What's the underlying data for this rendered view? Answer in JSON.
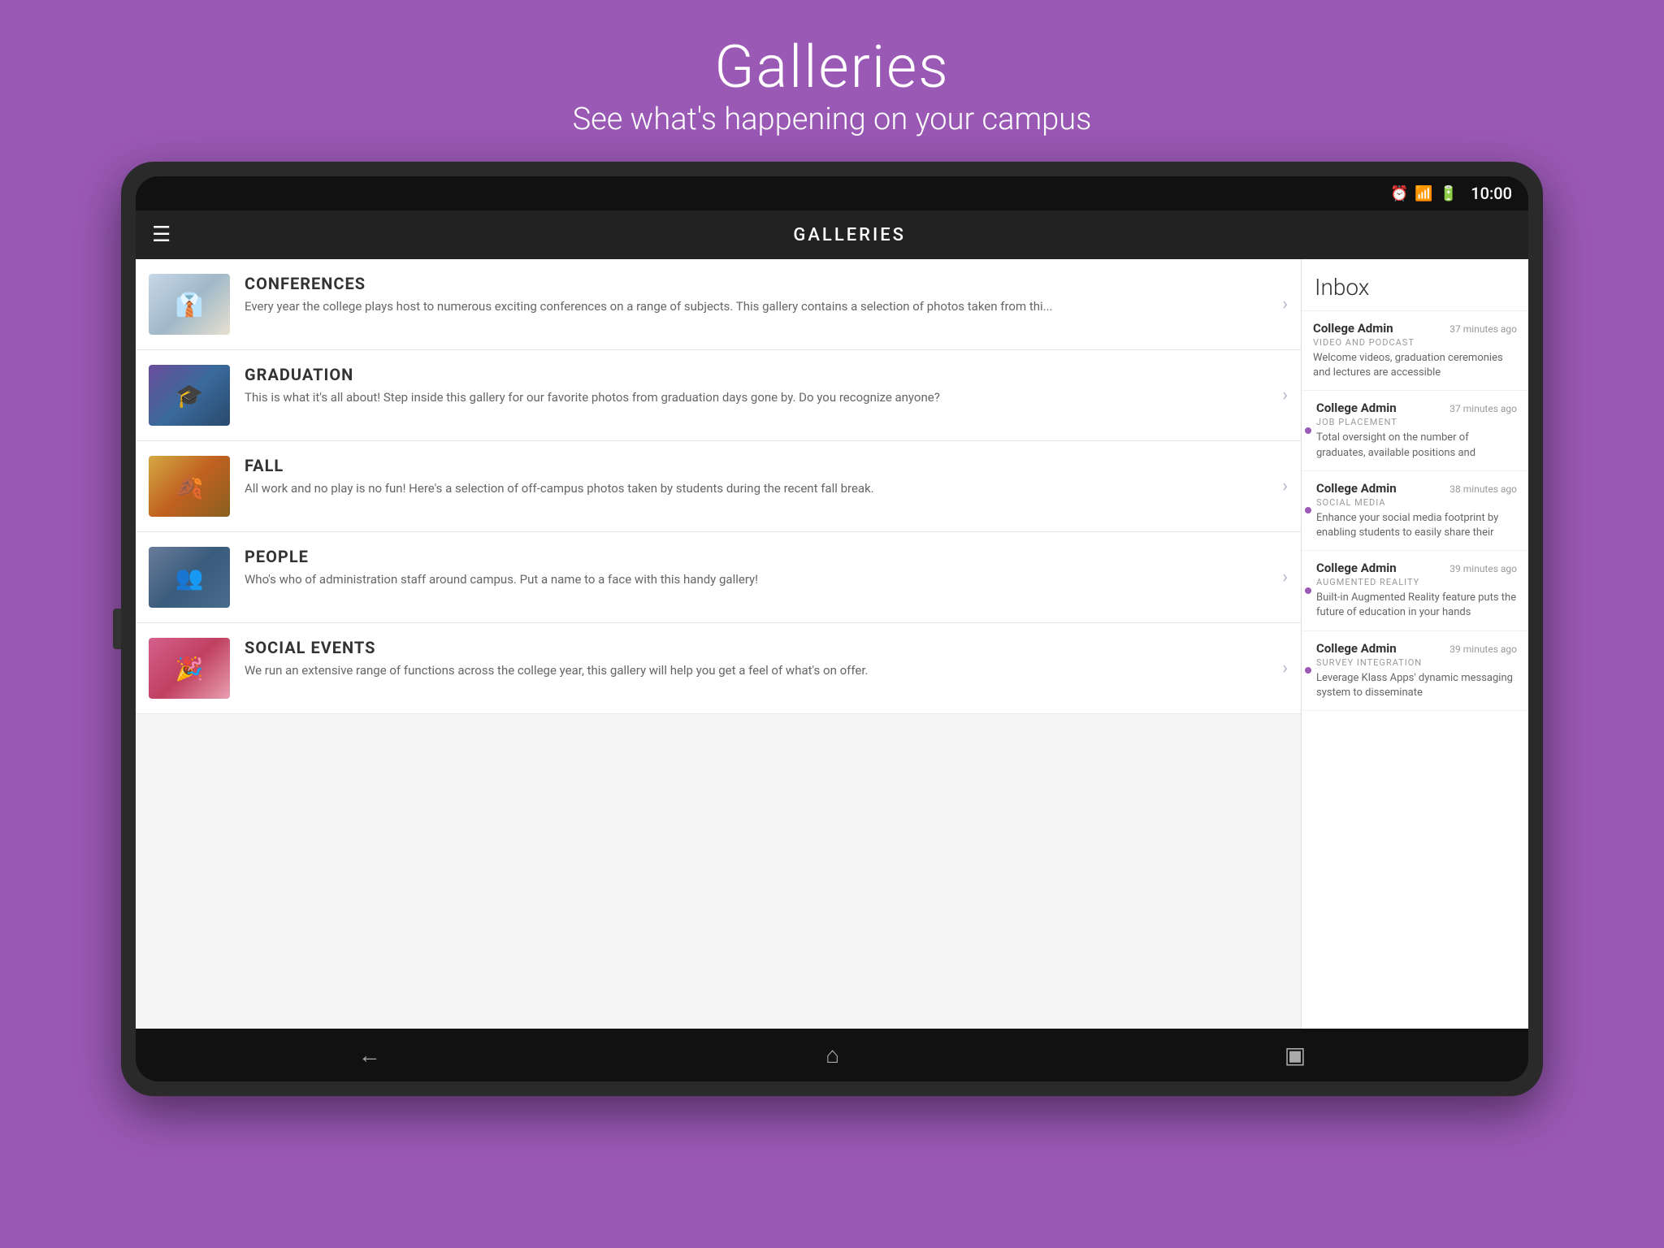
{
  "page": {
    "background_color": "#9b59b6",
    "title": "Galleries",
    "subtitle": "See what's happening on your campus"
  },
  "status_bar": {
    "time": "10:00",
    "icons": [
      "alarm",
      "wifi",
      "battery"
    ]
  },
  "app_bar": {
    "menu_icon": "☰",
    "title": "GALLERIES"
  },
  "gallery_items": [
    {
      "id": "conferences",
      "title": "CONFERENCES",
      "description": "Every year the college plays host to numerous exciting conferences on a range of subjects.  This gallery contains a selection of photos taken from thi...",
      "thumb_class": "thumb-conferences"
    },
    {
      "id": "graduation",
      "title": "GRADUATION",
      "description": "This is what it's all about!  Step inside this gallery for our favorite photos from graduation days gone by.  Do you recognize anyone?",
      "thumb_class": "thumb-graduation"
    },
    {
      "id": "fall",
      "title": "FALL",
      "description": "All work and no play is no fun!  Here's a selection of off-campus photos taken by students during the recent fall break.",
      "thumb_class": "thumb-fall"
    },
    {
      "id": "people",
      "title": "PEOPLE",
      "description": "Who's who of administration staff around campus.  Put a name to a face with this handy gallery!",
      "thumb_class": "thumb-people"
    },
    {
      "id": "social-events",
      "title": "SOCIAL EVENTS",
      "description": "We run an extensive range of functions across the college year, this gallery will help you get a feel of what's on offer.",
      "thumb_class": "thumb-social"
    }
  ],
  "inbox": {
    "title": "Inbox",
    "items": [
      {
        "sender": "College Admin",
        "time": "37 minutes ago",
        "category": "VIDEO AND PODCAST",
        "preview": "Welcome videos, graduation ceremonies and lectures are accessible",
        "unread": false
      },
      {
        "sender": "College Admin",
        "time": "37 minutes ago",
        "category": "JOB PLACEMENT",
        "preview": "Total oversight on the number of graduates, available positions and",
        "unread": true
      },
      {
        "sender": "College Admin",
        "time": "38 minutes ago",
        "category": "SOCIAL MEDIA",
        "preview": "Enhance your social media footprint by enabling students to easily share their",
        "unread": true
      },
      {
        "sender": "College Admin",
        "time": "39 minutes ago",
        "category": "AUGMENTED REALITY",
        "preview": "Built-in Augmented Reality feature puts the future of education in your hands",
        "unread": true
      },
      {
        "sender": "College Admin",
        "time": "39 minutes ago",
        "category": "SURVEY INTEGRATION",
        "preview": "Leverage Klass Apps' dynamic messaging system to disseminate",
        "unread": true
      }
    ]
  },
  "nav_bar": {
    "back_icon": "←",
    "home_icon": "⌂",
    "recent_icon": "▣"
  }
}
